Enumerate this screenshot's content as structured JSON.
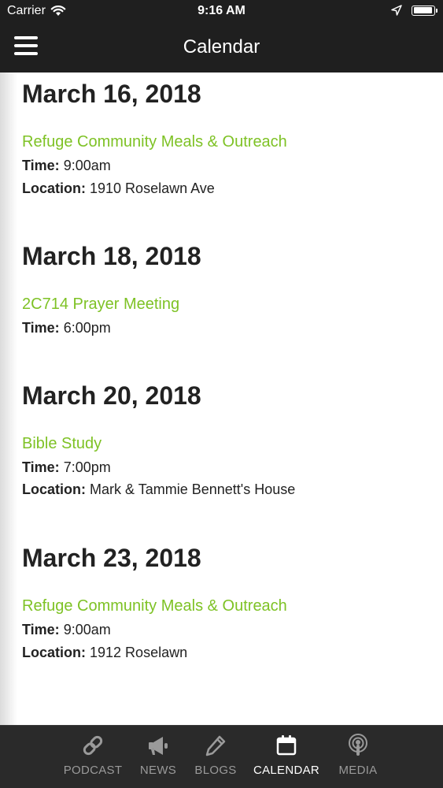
{
  "status_bar": {
    "carrier": "Carrier",
    "time": "9:16 AM"
  },
  "nav": {
    "title": "Calendar"
  },
  "events": [
    {
      "date": "March 16, 2018",
      "title": "Refuge Community Meals & Outreach",
      "time_label": "Time:",
      "time": "9:00am",
      "location_label": "Location:",
      "location": "1910 Roselawn Ave"
    },
    {
      "date": "March 18, 2018",
      "title": "2C714 Prayer Meeting",
      "time_label": "Time:",
      "time": "6:00pm"
    },
    {
      "date": "March 20, 2018",
      "title": "Bible Study",
      "time_label": "Time:",
      "time": "7:00pm",
      "location_label": "Location:",
      "location": "Mark & Tammie Bennett's House"
    },
    {
      "date": "March 23, 2018",
      "title": "Refuge Community Meals & Outreach",
      "time_label": "Time:",
      "time": "9:00am",
      "location_label": "Location:",
      "location": "1912 Roselawn"
    }
  ],
  "tabs": [
    {
      "label": "PODCAST",
      "icon": "link-icon"
    },
    {
      "label": "NEWS",
      "icon": "megaphone-icon"
    },
    {
      "label": "BLOGS",
      "icon": "pencil-icon"
    },
    {
      "label": "CALENDAR",
      "icon": "calendar-icon",
      "active": true
    },
    {
      "label": "MEDIA",
      "icon": "podcast-icon"
    }
  ],
  "colors": {
    "accent_green": "#7ec225",
    "bar_background": "#1f1f1f",
    "tab_inactive": "#9a9a9a"
  }
}
